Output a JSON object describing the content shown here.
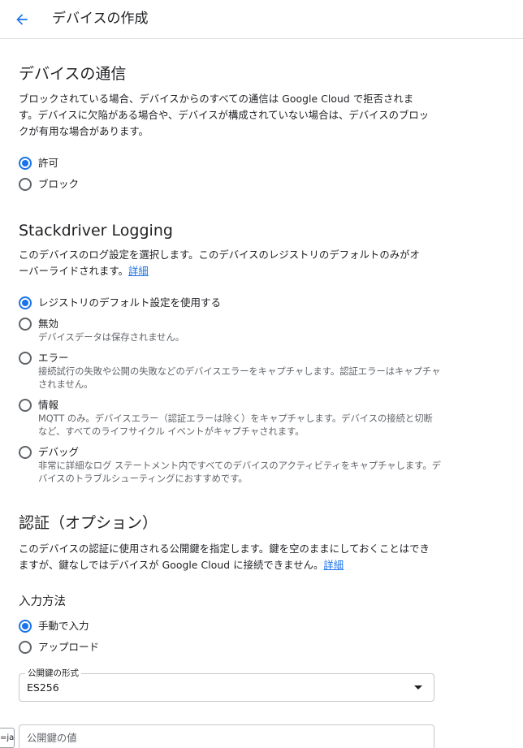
{
  "header": {
    "title": "デバイスの作成"
  },
  "communication": {
    "title": "デバイスの通信",
    "description": "ブロックされている場合、デバイスからのすべての通信は Google Cloud で拒否されます。デバイスに欠陥がある場合や、デバイスが構成されていない場合は、デバイスのブロックが有用な場合があります。",
    "options": [
      {
        "label": "許可",
        "checked": true
      },
      {
        "label": "ブロック",
        "checked": false
      }
    ]
  },
  "logging": {
    "title": "Stackdriver Logging",
    "description": "このデバイスのログ設定を選択します。このデバイスのレジストリのデフォルトのみがオーバーライドされます。",
    "link": "詳細",
    "options": [
      {
        "label": "レジストリのデフォルト設定を使用する",
        "sub": "",
        "checked": true
      },
      {
        "label": "無効",
        "sub": "デバイスデータは保存されません。",
        "checked": false
      },
      {
        "label": "エラー",
        "sub": "接続試行の失敗や公開の失敗などのデバイスエラーをキャプチャします。認証エラーはキャプチャされません。",
        "checked": false
      },
      {
        "label": "情報",
        "sub": "MQTT のみ。デバイスエラー（認証エラーは除く）をキャプチャします。デバイスの接続と切断など、すべてのライフサイクル イベントがキャプチャされます。",
        "checked": false
      },
      {
        "label": "デバッグ",
        "sub": "非常に詳細なログ ステートメント内ですべてのデバイスのアクティビティをキャプチャします。デバイスのトラブルシューティングにおすすめです。",
        "checked": false
      }
    ]
  },
  "auth": {
    "title": "認証（オプション）",
    "description": "このデバイスの認証に使用される公開鍵を指定します。鍵を空のままにしておくことはできますが、鍵なしではデバイスが Google Cloud に接続できません。",
    "link": "詳細",
    "input_method_title": "入力方法",
    "input_methods": [
      {
        "label": "手動で入力",
        "checked": true
      },
      {
        "label": "アップロード",
        "checked": false
      }
    ],
    "key_format_label": "公開鍵の形式",
    "key_format_value": "ES256",
    "key_value_placeholder": "公開鍵の値"
  },
  "lang_tag": "=ja",
  "colors": {
    "accent": "#1a73e8",
    "text": "#202124",
    "secondary": "#5f6368"
  }
}
